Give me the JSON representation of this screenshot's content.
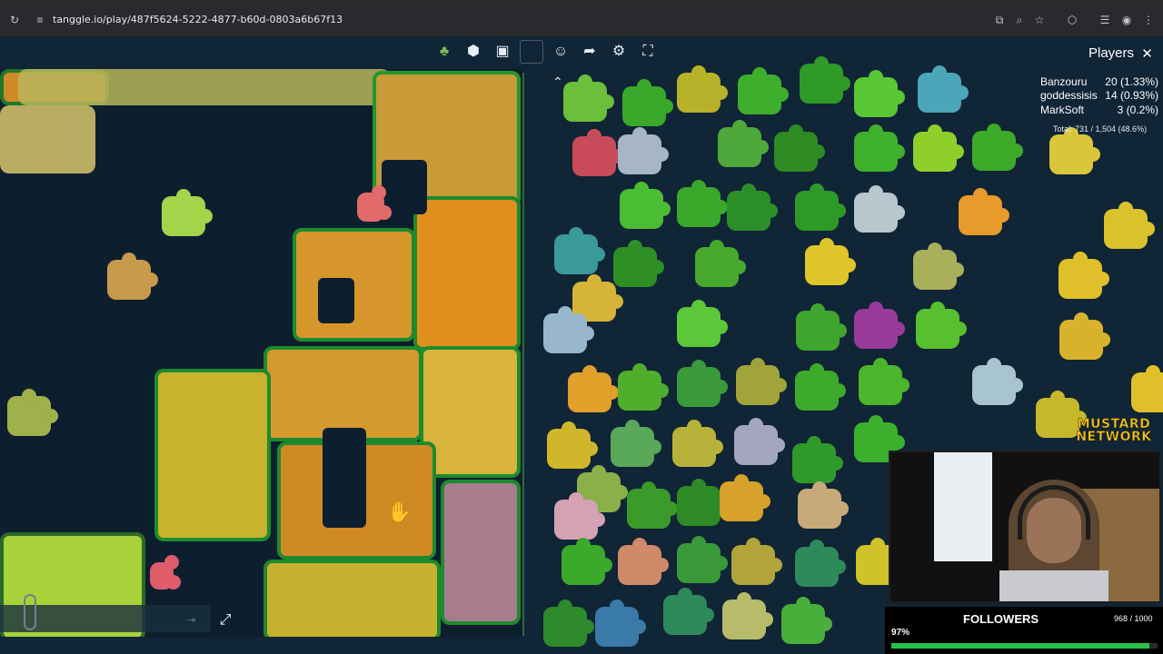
{
  "browser": {
    "url": "tanggle.io/play/487f5624-5222-4877-b60d-0803a6b67f13",
    "icons": [
      "reload-icon",
      "site-info-icon",
      "install-icon",
      "zoom-icon",
      "bookmark-star-icon",
      "extensions-icon",
      "media-icon",
      "profile-icon"
    ]
  },
  "toolbar": {
    "icons": [
      "puzzle-tree-icon",
      "piece-shape-icon",
      "image-preview-icon",
      "box-frame-icon",
      "players-icon",
      "share-icon",
      "settings-icon",
      "fullscreen-icon"
    ]
  },
  "players_panel": {
    "title": "Players",
    "players": [
      {
        "name": "Banzouru",
        "score": "20 (1.33%)"
      },
      {
        "name": "goddessisis",
        "score": "14 (0.93%)"
      },
      {
        "name": "MarkSoft",
        "score": "3 (0.2%)"
      }
    ],
    "total": "Total: 731 / 1,504 (48.6%)"
  },
  "overlay": {
    "brand_line1": "MUSTARD",
    "brand_line2": "NETWORK",
    "followers_label": "FOLLOWERS",
    "followers_count": "968 / 1000",
    "followers_pct": "97%",
    "followers_fraction": 0.968
  },
  "colors": {
    "board_bg": "#0d1f2e",
    "field_green": "#1e8a2e",
    "progress": "#27c24a",
    "brand": "#f3c623"
  }
}
